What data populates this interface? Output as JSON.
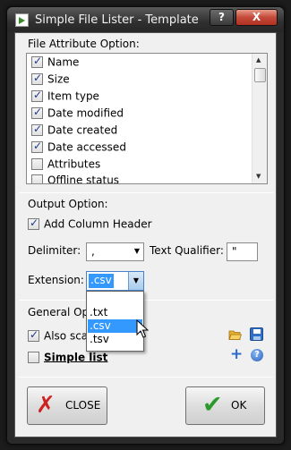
{
  "window": {
    "title": "Simple File Lister - Template"
  },
  "titlebar": {
    "help_label": "?",
    "close_label": "X"
  },
  "file_attribute": {
    "section_label": "File Attribute Option:",
    "items": [
      {
        "label": "Name",
        "checked": true
      },
      {
        "label": "Size",
        "checked": true
      },
      {
        "label": "Item type",
        "checked": true
      },
      {
        "label": "Date modified",
        "checked": true
      },
      {
        "label": "Date created",
        "checked": true
      },
      {
        "label": "Date accessed",
        "checked": true
      },
      {
        "label": "Attributes",
        "checked": false
      },
      {
        "label": "Offline status",
        "checked": false
      }
    ]
  },
  "output": {
    "section_label": "Output Option:",
    "add_column_header": {
      "label": "Add Column Header",
      "checked": true
    },
    "delimiter": {
      "label": "Delimiter:",
      "value": ","
    },
    "text_qualifier": {
      "label": "Text Qualifier:",
      "value": "\""
    },
    "extension": {
      "label": "Extension:",
      "value": ".csv",
      "options": [
        ".txt",
        ".csv",
        ".tsv"
      ],
      "highlighted": ".csv"
    }
  },
  "general": {
    "section_label": "General Opti",
    "also_scan": {
      "label": "Also scan",
      "checked": true
    },
    "simple_list": {
      "label": "Simple list",
      "checked": false
    }
  },
  "buttons": {
    "close": "CLOSE",
    "ok": "OK"
  }
}
